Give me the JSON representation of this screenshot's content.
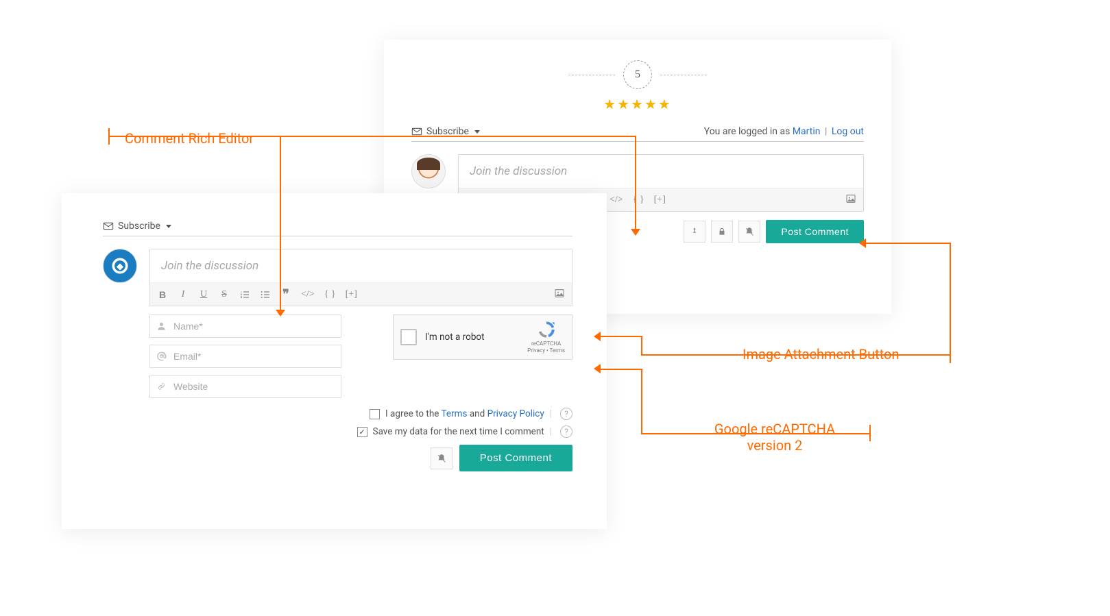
{
  "annotations": {
    "richEditor": "Comment Rich Editor",
    "imageAttach": "Image Attachment Button",
    "recaptcha1": "Google reCAPTCHA",
    "recaptcha2": "version 2"
  },
  "rating": {
    "count": "5"
  },
  "header": {
    "subscribe": "Subscribe",
    "loggedInPrefix": "You are logged in as ",
    "username": "Martin",
    "logout": "Log out"
  },
  "editor": {
    "placeholder": "Join the discussion",
    "glyphs": {
      "bold": "B",
      "italic": "I",
      "underline": "U",
      "strike": "S",
      "quote": "❞",
      "code": "</>",
      "braces": "{ }",
      "plus": "[+]"
    }
  },
  "postButton": "Post Comment",
  "fields": {
    "name": "Name*",
    "email": "Email*",
    "website": "Website"
  },
  "recaptcha": {
    "label": "I'm not a robot",
    "brand": "reCAPTCHA",
    "legal": "Privacy • Terms"
  },
  "consent": {
    "agreePrefix": "I agree to the ",
    "terms": "Terms",
    "and": " and ",
    "privacy": "Privacy Policy",
    "saveData": "Save my data for the next time I comment"
  }
}
